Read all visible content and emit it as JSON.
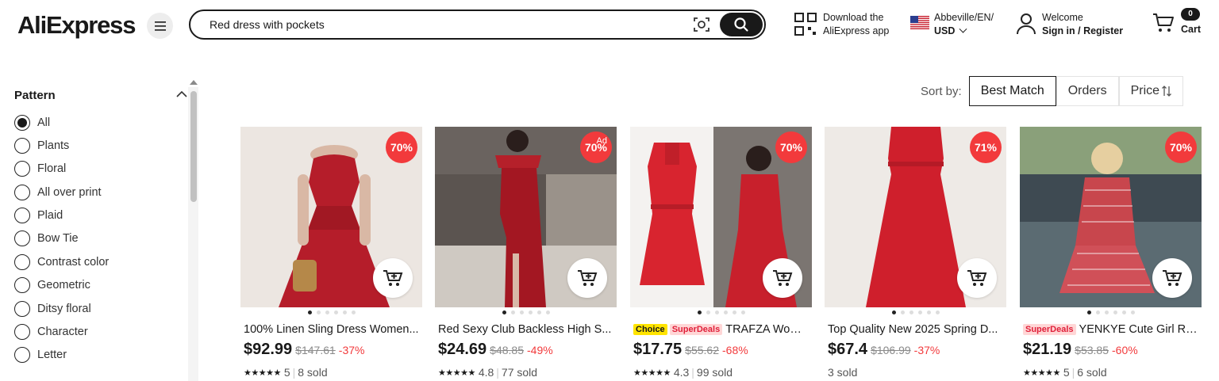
{
  "header": {
    "logo": "AliExpress",
    "search_value": "Red dress with pockets",
    "app_line1": "Download the",
    "app_line2": "AliExpress app",
    "region_line1": "Abbeville/EN/",
    "region_currency": "USD",
    "welcome": "Welcome",
    "signin": "Sign in / Register",
    "cart_label": "Cart",
    "cart_count": "0"
  },
  "filter": {
    "title": "Pattern",
    "options": [
      "All",
      "Plants",
      "Floral",
      "All over print",
      "Plaid",
      "Bow Tie",
      "Contrast color",
      "Geometric",
      "Ditsy floral",
      "Character",
      "Letter"
    ],
    "selected": "All"
  },
  "sort": {
    "label": "Sort by:",
    "options": [
      "Best Match",
      "Orders",
      "Price"
    ],
    "active": "Best Match"
  },
  "products": [
    {
      "title": "100% Linen Sling Dress Women...",
      "price": "$92.99",
      "orig": "$147.61",
      "pct": "-37%",
      "discount": "70%",
      "rating": "5",
      "sold": "8 sold",
      "stars": "★★★★★",
      "tags": []
    },
    {
      "title": "Red Sexy Club Backless High S...",
      "price": "$24.69",
      "orig": "$48.85",
      "pct": "-49%",
      "discount": "70%",
      "ad": "Ad",
      "rating": "4.8",
      "sold": "77 sold",
      "stars": "★★★★★",
      "tags": []
    },
    {
      "title": "TRAFZA Wome...",
      "price": "$17.75",
      "orig": "$55.62",
      "pct": "-68%",
      "discount": "70%",
      "rating": "4.3",
      "sold": "99 sold",
      "stars": "★★★★★",
      "tags": [
        "Choice",
        "SuperDeals"
      ]
    },
    {
      "title": "Top Quality New 2025 Spring D...",
      "price": "$67.4",
      "orig": "$106.99",
      "pct": "-37%",
      "discount": "71%",
      "rating": "",
      "sold": "3 sold",
      "stars": "",
      "tags": []
    },
    {
      "title": "YENKYE Cute Girl Re...",
      "price": "$21.19",
      "orig": "$53.85",
      "pct": "-60%",
      "discount": "70%",
      "rating": "5",
      "sold": "6 sold",
      "stars": "★★★★★",
      "tags": [
        "SuperDeals"
      ]
    }
  ]
}
